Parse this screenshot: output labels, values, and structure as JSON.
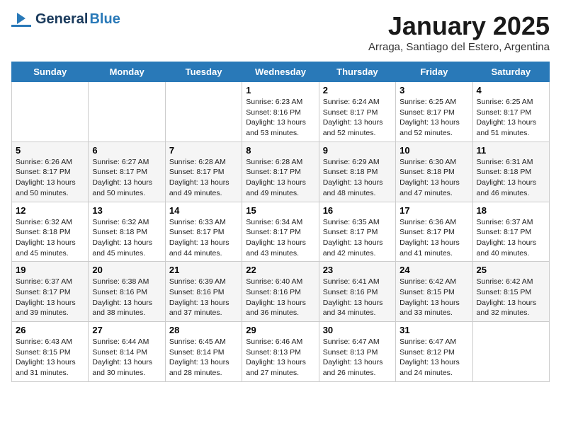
{
  "header": {
    "logo_general": "General",
    "logo_blue": "Blue",
    "title": "January 2025",
    "subtitle": "Arraga, Santiago del Estero, Argentina"
  },
  "weekdays": [
    "Sunday",
    "Monday",
    "Tuesday",
    "Wednesday",
    "Thursday",
    "Friday",
    "Saturday"
  ],
  "weeks": [
    [
      {
        "day": "",
        "detail": ""
      },
      {
        "day": "",
        "detail": ""
      },
      {
        "day": "",
        "detail": ""
      },
      {
        "day": "1",
        "detail": "Sunrise: 6:23 AM\nSunset: 8:16 PM\nDaylight: 13 hours\nand 53 minutes."
      },
      {
        "day": "2",
        "detail": "Sunrise: 6:24 AM\nSunset: 8:17 PM\nDaylight: 13 hours\nand 52 minutes."
      },
      {
        "day": "3",
        "detail": "Sunrise: 6:25 AM\nSunset: 8:17 PM\nDaylight: 13 hours\nand 52 minutes."
      },
      {
        "day": "4",
        "detail": "Sunrise: 6:25 AM\nSunset: 8:17 PM\nDaylight: 13 hours\nand 51 minutes."
      }
    ],
    [
      {
        "day": "5",
        "detail": "Sunrise: 6:26 AM\nSunset: 8:17 PM\nDaylight: 13 hours\nand 50 minutes."
      },
      {
        "day": "6",
        "detail": "Sunrise: 6:27 AM\nSunset: 8:17 PM\nDaylight: 13 hours\nand 50 minutes."
      },
      {
        "day": "7",
        "detail": "Sunrise: 6:28 AM\nSunset: 8:17 PM\nDaylight: 13 hours\nand 49 minutes."
      },
      {
        "day": "8",
        "detail": "Sunrise: 6:28 AM\nSunset: 8:17 PM\nDaylight: 13 hours\nand 49 minutes."
      },
      {
        "day": "9",
        "detail": "Sunrise: 6:29 AM\nSunset: 8:18 PM\nDaylight: 13 hours\nand 48 minutes."
      },
      {
        "day": "10",
        "detail": "Sunrise: 6:30 AM\nSunset: 8:18 PM\nDaylight: 13 hours\nand 47 minutes."
      },
      {
        "day": "11",
        "detail": "Sunrise: 6:31 AM\nSunset: 8:18 PM\nDaylight: 13 hours\nand 46 minutes."
      }
    ],
    [
      {
        "day": "12",
        "detail": "Sunrise: 6:32 AM\nSunset: 8:18 PM\nDaylight: 13 hours\nand 45 minutes."
      },
      {
        "day": "13",
        "detail": "Sunrise: 6:32 AM\nSunset: 8:18 PM\nDaylight: 13 hours\nand 45 minutes."
      },
      {
        "day": "14",
        "detail": "Sunrise: 6:33 AM\nSunset: 8:17 PM\nDaylight: 13 hours\nand 44 minutes."
      },
      {
        "day": "15",
        "detail": "Sunrise: 6:34 AM\nSunset: 8:17 PM\nDaylight: 13 hours\nand 43 minutes."
      },
      {
        "day": "16",
        "detail": "Sunrise: 6:35 AM\nSunset: 8:17 PM\nDaylight: 13 hours\nand 42 minutes."
      },
      {
        "day": "17",
        "detail": "Sunrise: 6:36 AM\nSunset: 8:17 PM\nDaylight: 13 hours\nand 41 minutes."
      },
      {
        "day": "18",
        "detail": "Sunrise: 6:37 AM\nSunset: 8:17 PM\nDaylight: 13 hours\nand 40 minutes."
      }
    ],
    [
      {
        "day": "19",
        "detail": "Sunrise: 6:37 AM\nSunset: 8:17 PM\nDaylight: 13 hours\nand 39 minutes."
      },
      {
        "day": "20",
        "detail": "Sunrise: 6:38 AM\nSunset: 8:16 PM\nDaylight: 13 hours\nand 38 minutes."
      },
      {
        "day": "21",
        "detail": "Sunrise: 6:39 AM\nSunset: 8:16 PM\nDaylight: 13 hours\nand 37 minutes."
      },
      {
        "day": "22",
        "detail": "Sunrise: 6:40 AM\nSunset: 8:16 PM\nDaylight: 13 hours\nand 36 minutes."
      },
      {
        "day": "23",
        "detail": "Sunrise: 6:41 AM\nSunset: 8:16 PM\nDaylight: 13 hours\nand 34 minutes."
      },
      {
        "day": "24",
        "detail": "Sunrise: 6:42 AM\nSunset: 8:15 PM\nDaylight: 13 hours\nand 33 minutes."
      },
      {
        "day": "25",
        "detail": "Sunrise: 6:42 AM\nSunset: 8:15 PM\nDaylight: 13 hours\nand 32 minutes."
      }
    ],
    [
      {
        "day": "26",
        "detail": "Sunrise: 6:43 AM\nSunset: 8:15 PM\nDaylight: 13 hours\nand 31 minutes."
      },
      {
        "day": "27",
        "detail": "Sunrise: 6:44 AM\nSunset: 8:14 PM\nDaylight: 13 hours\nand 30 minutes."
      },
      {
        "day": "28",
        "detail": "Sunrise: 6:45 AM\nSunset: 8:14 PM\nDaylight: 13 hours\nand 28 minutes."
      },
      {
        "day": "29",
        "detail": "Sunrise: 6:46 AM\nSunset: 8:13 PM\nDaylight: 13 hours\nand 27 minutes."
      },
      {
        "day": "30",
        "detail": "Sunrise: 6:47 AM\nSunset: 8:13 PM\nDaylight: 13 hours\nand 26 minutes."
      },
      {
        "day": "31",
        "detail": "Sunrise: 6:47 AM\nSunset: 8:12 PM\nDaylight: 13 hours\nand 24 minutes."
      },
      {
        "day": "",
        "detail": ""
      }
    ]
  ]
}
